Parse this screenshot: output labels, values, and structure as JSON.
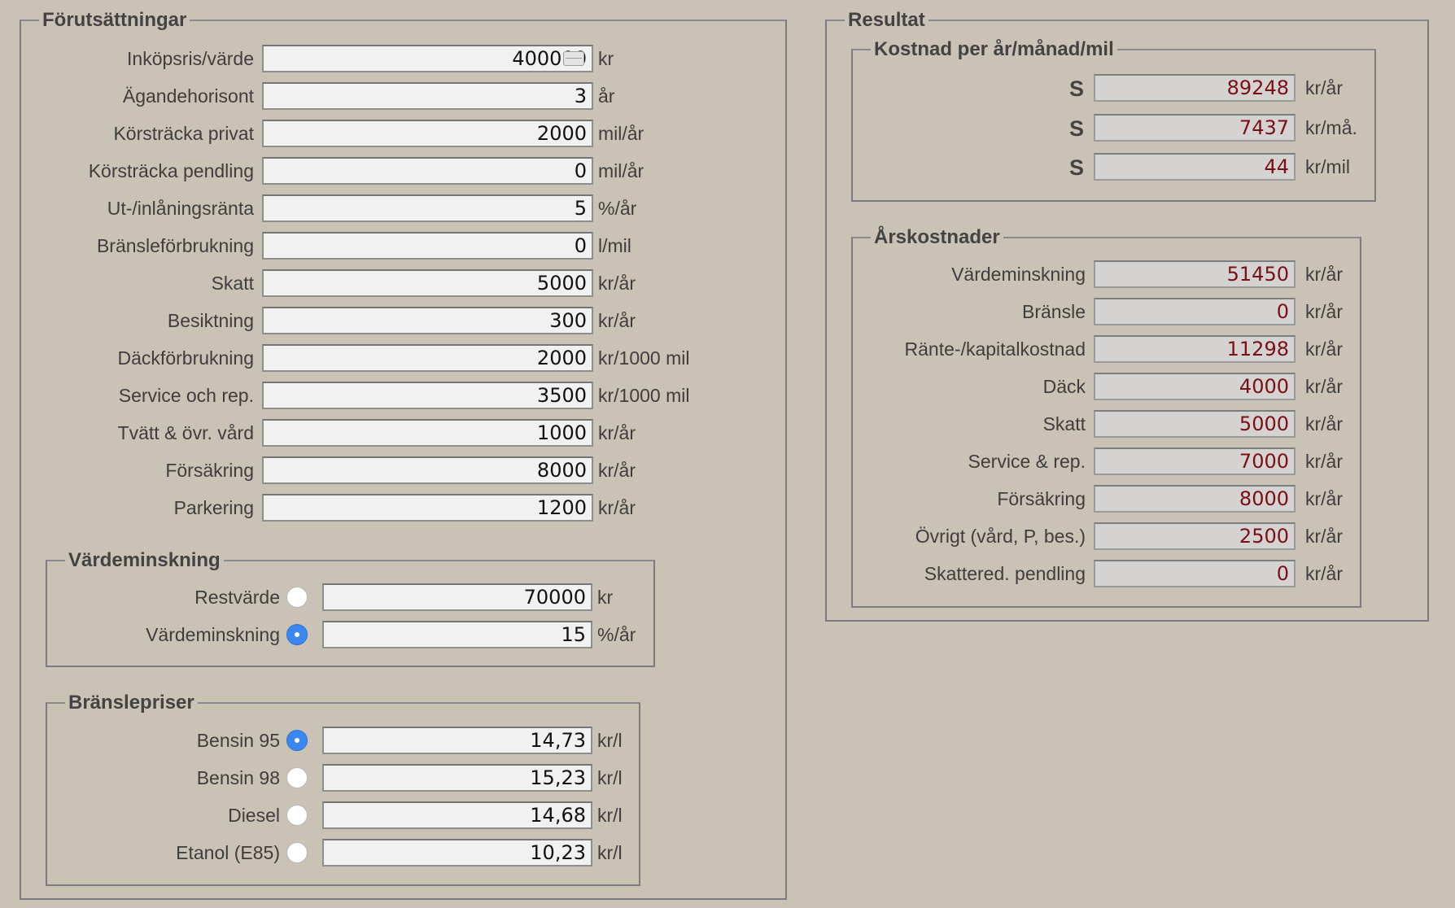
{
  "forutsattningar": {
    "title": "Förutsättningar",
    "rows": [
      {
        "label": "Inköpsris/värde",
        "value": "400000",
        "unit": "kr"
      },
      {
        "label": "Ägandehorisont",
        "value": "3",
        "unit": "år"
      },
      {
        "label": "Körsträcka privat",
        "value": "2000",
        "unit": "mil/år"
      },
      {
        "label": "Körsträcka pendling",
        "value": "0",
        "unit": "mil/år"
      },
      {
        "label": "Ut-/inlåningsränta",
        "value": "5",
        "unit": "%/år"
      },
      {
        "label": "Bränsleförbrukning",
        "value": "0",
        "unit": "l/mil"
      },
      {
        "label": "Skatt",
        "value": "5000",
        "unit": "kr/år"
      },
      {
        "label": "Besiktning",
        "value": "300",
        "unit": "kr/år"
      },
      {
        "label": "Däckförbrukning",
        "value": "2000",
        "unit": "kr/1000 mil"
      },
      {
        "label": "Service och rep.",
        "value": "3500",
        "unit": "kr/1000 mil"
      },
      {
        "label": "Tvätt & övr. vård",
        "value": "1000",
        "unit": "kr/år"
      },
      {
        "label": "Försäkring",
        "value": "8000",
        "unit": "kr/år"
      },
      {
        "label": "Parkering",
        "value": "1200",
        "unit": "kr/år"
      }
    ]
  },
  "vardeminskning": {
    "title": "Värdeminskning",
    "rows": [
      {
        "label": "Restvärde",
        "value": "70000",
        "unit": "kr",
        "selected": false
      },
      {
        "label": "Värdeminskning",
        "value": "15",
        "unit": "%/år",
        "selected": true
      }
    ]
  },
  "branslepriser": {
    "title": "Bränslepriser",
    "rows": [
      {
        "label": "Bensin 95",
        "value": "14,73",
        "unit": "kr/l",
        "selected": true
      },
      {
        "label": "Bensin 98",
        "value": "15,23",
        "unit": "kr/l",
        "selected": false
      },
      {
        "label": "Diesel",
        "value": "14,68",
        "unit": "kr/l",
        "selected": false
      },
      {
        "label": "Etanol (E85)",
        "value": "10,23",
        "unit": "kr/l",
        "selected": false
      }
    ]
  },
  "resultat": {
    "title": "Resultat",
    "kostnad": {
      "title": "Kostnad per år/månad/mil",
      "rows": [
        {
          "icon": "S",
          "value": "89248",
          "unit": "kr/år"
        },
        {
          "icon": "S",
          "value": "7437",
          "unit": "kr/må."
        },
        {
          "icon": "S",
          "value": "44",
          "unit": "kr/mil"
        }
      ]
    },
    "arskostnader": {
      "title": "Årskostnader",
      "rows": [
        {
          "label": "Värdeminskning",
          "value": "51450",
          "unit": "kr/år"
        },
        {
          "label": "Bränsle",
          "value": "0",
          "unit": "kr/år"
        },
        {
          "label": "Ränte-/kapitalkostnad",
          "value": "11298",
          "unit": "kr/år"
        },
        {
          "label": "Däck",
          "value": "4000",
          "unit": "kr/år"
        },
        {
          "label": "Skatt",
          "value": "5000",
          "unit": "kr/år"
        },
        {
          "label": "Service & rep.",
          "value": "7000",
          "unit": "kr/år"
        },
        {
          "label": "Försäkring",
          "value": "8000",
          "unit": "kr/år"
        },
        {
          "label": "Övrigt (vård, P, bes.)",
          "value": "2500",
          "unit": "kr/år"
        },
        {
          "label": "Skattered. pendling",
          "value": "0",
          "unit": "kr/år"
        }
      ]
    }
  },
  "colors": {
    "background": "#cbc2b6",
    "output_text": "#7a0f14",
    "radio_selected": "#3b87f0"
  }
}
